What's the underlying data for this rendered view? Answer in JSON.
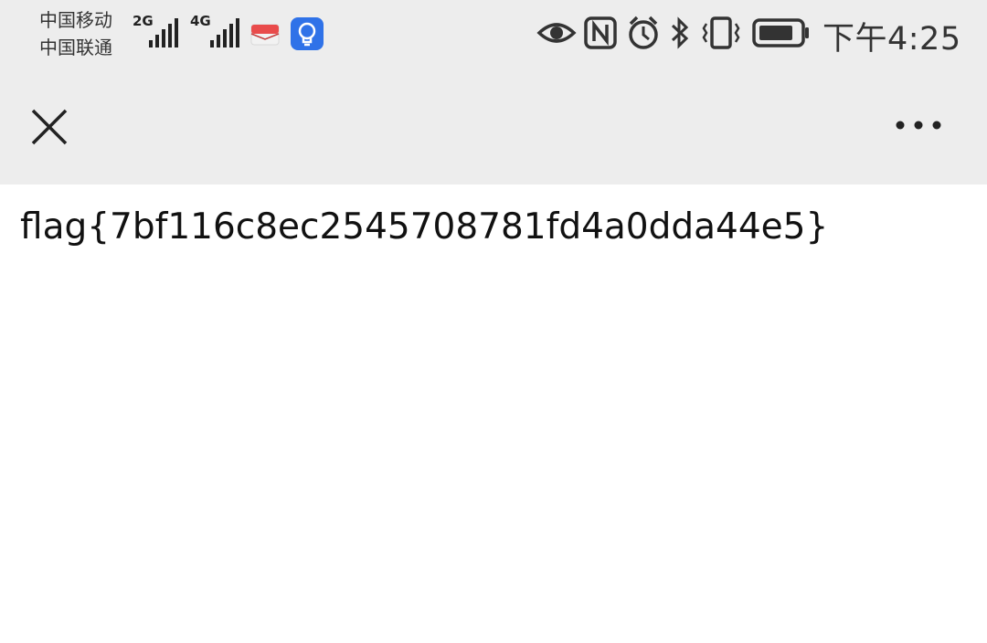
{
  "status_bar": {
    "carrier_1": "中国移动",
    "carrier_2": "中国联通",
    "signal_1_type": "2G",
    "signal_2_type": "4G",
    "time": "下午4:25",
    "icons": [
      "eye-icon",
      "nfc-icon",
      "alarm-icon",
      "bluetooth-icon",
      "vibrate-icon",
      "battery-icon"
    ]
  },
  "navbar": {
    "close_icon": "close-icon",
    "more_icon": "more-icon"
  },
  "content": {
    "text": "flag{7bf116c8ec2545708781fd4a0dda44e5}"
  }
}
